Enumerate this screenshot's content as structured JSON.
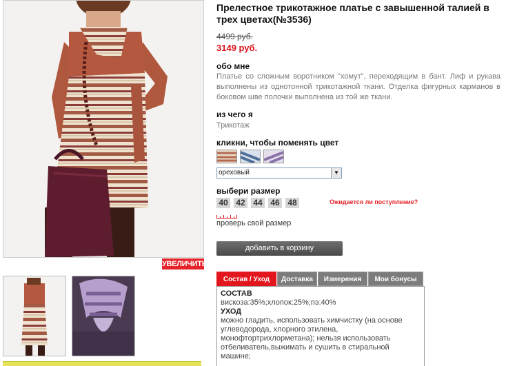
{
  "product": {
    "title": "Прелестное трикотажное платье с завышенной талией в трех цветах(№3536)",
    "old_price": "4499 руб.",
    "new_price": "3149 руб."
  },
  "gallery": {
    "zoom_label": "УВЕЛИЧИТЬ"
  },
  "about": {
    "heading": "обо мне",
    "text": "Платье со сложным воротником \"хомут\", переходящим в бант. Лиф и рукава выполнены из однотонной трикотажной ткани. Отделка фигурных карманов в боковом шве полочки выполнена из той же ткани."
  },
  "material": {
    "heading": "из чего я",
    "text": "Трикотаж"
  },
  "colors": {
    "heading": "кликни, чтобы поменять цвет",
    "selected": "ореховый",
    "swatch_colors": [
      "#b46a52",
      "#4f6f98",
      "#8a72a8"
    ]
  },
  "sizes": {
    "heading": "выбери размер",
    "options": [
      "40",
      "42",
      "44",
      "46",
      "48"
    ],
    "restock_link": "Ожидается ли поступление?",
    "check_size": "проверь свой размер"
  },
  "cart": {
    "button_label": "добавить в корзину"
  },
  "tabs": [
    {
      "label": "Состав / Уход",
      "active": true
    },
    {
      "label": "Доставка",
      "active": false
    },
    {
      "label": "Измерения",
      "active": false
    },
    {
      "label": "Мои бонусы",
      "active": false
    }
  ],
  "tab_panel": {
    "composition_heading": "СОСТАВ",
    "composition_text": "вискоза:35%;хлопок:25%;пэ:40%",
    "care_heading": "УХОД",
    "care_text": "можно гладить, использовать химчистку (на основе углеводорода, хлорного этилена, монофтортрихлорметана); нельзя использовать отбеливатель,выжимать и сушить в стиральной машине;"
  },
  "accent_colors": {
    "red": "#e3161d",
    "tab_gray": "#7c7c7c",
    "button_dark": "#4a4a4a"
  }
}
